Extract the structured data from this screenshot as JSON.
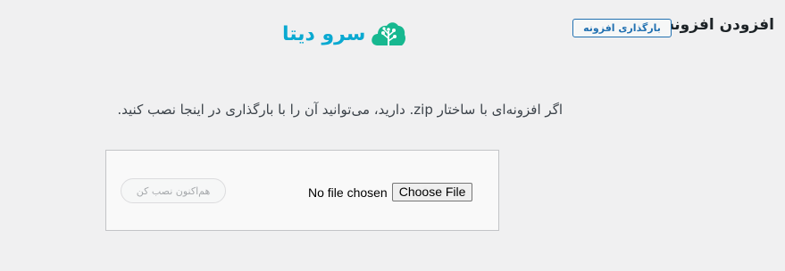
{
  "header": {
    "title": "افزودن افزونه",
    "upload_button": "بارگذاری افزونه"
  },
  "brand": {
    "name": "سرو دیتا",
    "logo_icon": "cloud-tree-icon",
    "colors": {
      "cloud": "#17b890",
      "tree": "#ffffff",
      "text": "#0aa9d1"
    }
  },
  "main": {
    "instruction": "اگر افزونه‌ای با ساختار zip. دارید، می‌توانید آن را با بارگذاری در اینجا نصب کنید."
  },
  "upload_form": {
    "file_status": "No file chosen",
    "choose_file_label": "Choose File",
    "install_button": "هم‌اکنون نصب کن"
  },
  "colors": {
    "accent": "#2271b1",
    "background": "#f0f0f1"
  }
}
